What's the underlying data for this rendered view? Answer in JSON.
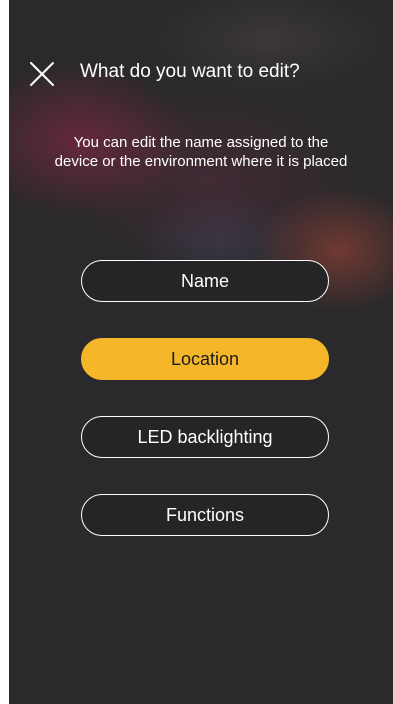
{
  "header": {
    "close_icon": "close-icon",
    "title": "What do you want to edit?"
  },
  "description": {
    "line1": "You can edit the name assigned to the",
    "line2": "device or the environment where it is placed"
  },
  "options": [
    {
      "label": "Name",
      "selected": false
    },
    {
      "label": "Location",
      "selected": true
    },
    {
      "label": "LED backlighting",
      "selected": false
    },
    {
      "label": "Functions",
      "selected": false
    }
  ],
  "colors": {
    "background": "#2a292b",
    "accent": "#f5b729",
    "text": "#ffffff"
  }
}
